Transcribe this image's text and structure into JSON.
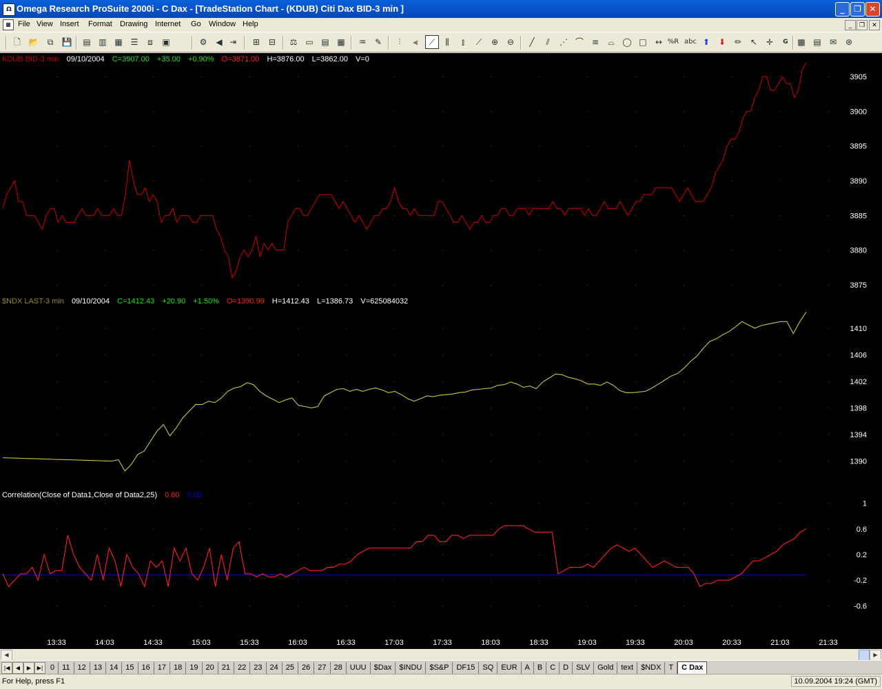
{
  "window": {
    "title": "Omega Research ProSuite 2000i - C Dax - [TradeStation Chart - (KDUB) Citi Dax BID-3 min ]",
    "icon": "tradestation-app-icon",
    "doc_icon": "chart-document-icon",
    "controls": [
      "minimize-icon",
      "restore-icon",
      "close-icon"
    ]
  },
  "menu": {
    "items": [
      "File",
      "View",
      "Insert",
      "Format",
      "Drawing",
      "Internet",
      "Go",
      "Window",
      "Help"
    ],
    "mdi_controls": [
      "minimize-icon",
      "restore-icon",
      "close-icon"
    ]
  },
  "toolbar": {
    "icons": [
      "new-icon",
      "open-icon",
      "copy-icon",
      "save-icon",
      "print-icon",
      "layout-icon",
      "layout-icon",
      "layout-icon",
      "layout-icon",
      "settings-icon",
      "back-icon",
      "forward-icon",
      "insert-icon",
      "insert-icon",
      "indicator-icon",
      "window-icon",
      "grid-icon",
      "table-icon",
      "pattern-icon",
      "paint-icon",
      "bar-chart-icon",
      "zoom-bars-icon",
      "line-chart-icon",
      "candle-icon",
      "candle-icon",
      "trend-icon",
      "zoom-in-icon",
      "zoom-out-icon",
      "curve-icon",
      "fibonacci-icon",
      "fan-icon",
      "arc-icon",
      "lines-icon",
      "speed-icon",
      "ellipse-icon",
      "rectangle-icon",
      "horizontal-arrow-icon",
      "percent-retracement-icon",
      "text-icon",
      "buy-arrow-icon",
      "sell-arrow-icon",
      "pencil-icon",
      "pointer-icon",
      "crosshair-icon",
      "grid-marker-icon",
      "chart-icon",
      "table-icon",
      "sound-icon",
      "camera-icon"
    ],
    "active": "line-chart-icon",
    "glyphs": {
      "percent_r": "%R",
      "abc": "abc",
      "g": "G"
    }
  },
  "chart": {
    "panes": [
      {
        "header": {
          "symbol": "KDUB BID-3 min",
          "date": "09/10/2004",
          "close": "C=3907.00",
          "change": "+35.00",
          "pct": "+0.90%",
          "open": "O=3871.00",
          "high": "H=3876.00",
          "low": "L=3862.00",
          "volume": "V=0"
        },
        "axis_labels": [
          "3905",
          "3900",
          "3895",
          "3890",
          "3885",
          "3880",
          "3875"
        ]
      },
      {
        "header": {
          "symbol": "$NDX LAST-3 min",
          "date": "09/10/2004",
          "close": "C=1412.43",
          "change": "+20.90",
          "pct": "+1.50%",
          "open": "O=1390.99",
          "high": "H=1412.43",
          "low": "L=1386.73",
          "volume": "V=625084032"
        },
        "axis_labels": [
          "1410",
          "1406",
          "1402",
          "1398",
          "1394",
          "1390"
        ]
      },
      {
        "header": {
          "study": "Correlation(Close of Data1,Close of Data2,25)",
          "value1": "0.60",
          "value2": "0.00"
        },
        "axis_labels": [
          "1",
          "0.6",
          "0.2",
          "-0.2",
          "-0.6"
        ]
      }
    ],
    "time_labels": [
      "13:33",
      "14:03",
      "14:33",
      "15:03",
      "15:33",
      "16:03",
      "16:33",
      "17:03",
      "17:33",
      "18:03",
      "18:33",
      "19:03",
      "19:33",
      "20:03",
      "20:33",
      "21:03",
      "21:33"
    ],
    "colors": {
      "kdub_line": "#c00000",
      "kdub_symbol": "#c00000",
      "ndx_line": "#c8c832",
      "ndx_symbol": "#8c8c32",
      "correlation_line": "#ff2020",
      "zero_line": "#0000e0",
      "positive": "#20e020",
      "negative": "#ff2020",
      "text": "#ffffff",
      "grid_dot": "#5a5a5a"
    }
  },
  "chart_data": [
    {
      "type": "line",
      "series": [
        {
          "name": "KDUB BID-3 min",
          "values": [
            3886,
            3888,
            3889,
            3890,
            3887,
            3887,
            3885,
            3885,
            3885,
            3884,
            3883,
            3885,
            3886,
            3886,
            3884,
            3885,
            3884,
            3884,
            3884,
            3885,
            3886,
            3885,
            3885,
            3885,
            3886,
            3885,
            3885,
            3885,
            3886,
            3885,
            3885,
            3888,
            3893,
            3890,
            3888,
            3888,
            3889,
            3887,
            3888,
            3887,
            3884,
            3885,
            3885,
            3886,
            3884,
            3885,
            3885,
            3885,
            3884,
            3884,
            3885,
            3885,
            3885,
            3885,
            3883,
            3882,
            3880,
            3879,
            3876,
            3877,
            3879,
            3880,
            3879,
            3880,
            3882,
            3879,
            3881,
            3880,
            3881,
            3880,
            3880,
            3880,
            3884,
            3885,
            3886,
            3886,
            3885,
            3885,
            3886,
            3887,
            3888,
            3888,
            3888,
            3888,
            3887,
            3886,
            3887,
            3886,
            3885,
            3884,
            3885,
            3884,
            3883,
            3884,
            3885,
            3885,
            3886,
            3886,
            3887,
            3889,
            3887,
            3886,
            3886,
            3885,
            3886,
            3885,
            3885,
            3885,
            3885,
            3885,
            3887,
            3887,
            3886,
            3885,
            3884,
            3884,
            3885,
            3884,
            3883,
            3884,
            3884,
            3885,
            3884,
            3884,
            3885,
            3885,
            3886,
            3886,
            3885,
            3885,
            3886,
            3886,
            3886,
            3885,
            3886,
            3886,
            3886,
            3886,
            3886,
            3887,
            3886,
            3886,
            3885,
            3886,
            3886,
            3886,
            3886,
            3885,
            3886,
            3885,
            3885,
            3886,
            3887,
            3886,
            3886,
            3886,
            3887,
            3886,
            3885,
            3886,
            3887,
            3887,
            3888,
            3888,
            3888,
            3889,
            3889,
            3889,
            3889,
            3889,
            3888,
            3887,
            3888,
            3889,
            3888,
            3887,
            3887,
            3887,
            3888,
            3889,
            3891,
            3892,
            3893,
            3895,
            3896,
            3896,
            3897,
            3899,
            3900,
            3900,
            3902,
            3903,
            3905,
            3905,
            3903,
            3903,
            3904,
            3905,
            3904,
            3904,
            3902,
            3903,
            3906,
            3907
          ]
        }
      ],
      "ylim": [
        3874,
        3907
      ]
    },
    {
      "type": "line",
      "series": [
        {
          "name": "$NDX LAST-3 min",
          "values": [
            1390.5,
            1390.47,
            1390.44,
            1390.41,
            1390.38,
            1390.35,
            1390.32,
            1390.29,
            1390.26,
            1390.23,
            1390.2,
            1390.17,
            1390.14,
            1390.11,
            1390.08,
            1390.05,
            1390.02,
            1390.0,
            1390.2,
            1388.5,
            1389.5,
            1391,
            1391.5,
            1393,
            1394.5,
            1395.5,
            1393.8,
            1395,
            1396.5,
            1397.5,
            1398.5,
            1398.5,
            1399,
            1398.8,
            1399.5,
            1400.5,
            1401,
            1401.2,
            1401.8,
            1401.5,
            1400.5,
            1399.8,
            1399.3,
            1398.8,
            1399.2,
            1399.5,
            1398.4,
            1398.2,
            1398.0,
            1398.2,
            1399.8,
            1400.3,
            1400.8,
            1400.9,
            1400.5,
            1400.8,
            1400.5,
            1400.8,
            1401.0,
            1400.7,
            1400.3,
            1400.5,
            1400.0,
            1399.4,
            1399.0,
            1399.4,
            1399.8,
            1399.7,
            1399.9,
            1400.0,
            1400.1,
            1400.3,
            1400.4,
            1400.7,
            1400.8,
            1400.9,
            1401.0,
            1401.4,
            1401.5,
            1401.9,
            1401.6,
            1401.1,
            1401.3,
            1400.9,
            1401.9,
            1402.5,
            1403.1,
            1403.0,
            1402.6,
            1402.4,
            1402.1,
            1401.6,
            1401.6,
            1401.4,
            1401.9,
            1401.4,
            1400.6,
            1400.3,
            1400.3,
            1400.4,
            1400.5,
            1401.0,
            1401.6,
            1402.2,
            1402.8,
            1403.2,
            1404.0,
            1405.0,
            1405.8,
            1407.0,
            1408.0,
            1408.4,
            1409.0,
            1409.5,
            1410.2,
            1411.0,
            1410.5,
            1410.0,
            1410.4,
            1410.6,
            1410.8,
            1411.0,
            1411.0,
            1409.2,
            1411.0,
            1412.43
          ]
        }
      ],
      "ylim": [
        1386,
        1413
      ]
    },
    {
      "type": "line",
      "series": [
        {
          "name": "Correlation(Close of Data1,Close of Data2,25)",
          "values": [
            -0.1,
            -0.3,
            -0.2,
            -0.1,
            -0.1,
            0.0,
            -0.2,
            0.2,
            -0.1,
            -0.05,
            -0.05,
            0.5,
            0.2,
            0.0,
            -0.1,
            -0.2,
            0.2,
            -0.2,
            0.3,
            0.1,
            -0.3,
            0.2,
            0.0,
            -0.1,
            -0.3,
            0.1,
            0.0,
            0.1,
            -0.3,
            0.3,
            0.1,
            0.3,
            -0.1,
            -0.2,
            0.0,
            0.3,
            -0.3,
            0.2,
            -0.2,
            0.3,
            0.4,
            -0.1,
            -0.1,
            -0.15,
            -0.1,
            -0.15,
            -0.15,
            -0.1,
            -0.15,
            -0.1,
            -0.05,
            0.0,
            -0.05,
            -0.05,
            -0.05,
            0.0,
            0.0,
            0.05,
            0.05,
            0.1,
            0.2,
            0.25,
            0.3,
            0.3,
            0.3,
            0.3,
            0.3,
            0.3,
            0.3,
            0.3,
            0.4,
            0.4,
            0.5,
            0.5,
            0.4,
            0.4,
            0.5,
            0.5,
            0.45,
            0.5,
            0.5,
            0.5,
            0.5,
            0.5,
            0.6,
            0.65,
            0.65,
            0.65,
            0.65,
            0.6,
            0.55,
            0.55,
            0.55,
            0.55,
            -0.1,
            -0.05,
            0.0,
            0.0,
            0.0,
            0.05,
            0.0,
            0.1,
            0.2,
            0.3,
            0.35,
            0.3,
            0.25,
            0.3,
            0.2,
            0.1,
            0.0,
            0.05,
            0.1,
            0.05,
            0.0,
            0.0,
            0.0,
            -0.1,
            -0.3,
            -0.25,
            -0.25,
            -0.2,
            -0.2,
            -0.2,
            -0.15,
            -0.1,
            0.0,
            0.1,
            0.1,
            0.15,
            0.2,
            0.25,
            0.35,
            0.4,
            0.45,
            0.55,
            0.6
          ]
        },
        {
          "name": "zero",
          "values": [
            0,
            0
          ]
        }
      ],
      "ylim": [
        -0.8,
        1.05
      ]
    }
  ],
  "tabs": {
    "items": [
      "0",
      "11",
      "12",
      "13",
      "14",
      "15",
      "16",
      "17",
      "18",
      "19",
      "20",
      "21",
      "22",
      "23",
      "24",
      "25",
      "26",
      "27",
      "28",
      "UUU",
      "$Dax",
      "$INDU",
      "$S&P",
      "DF15",
      "SQ",
      "EUR",
      "A",
      "B",
      "C",
      "D",
      "SLV",
      "Gold",
      "text",
      "$NDX",
      "T",
      "C Dax"
    ],
    "active": "C Dax",
    "nav_icons": [
      "first-tab-icon",
      "prev-tab-icon",
      "next-tab-icon",
      "last-tab-icon"
    ]
  },
  "status": {
    "help": "For Help, press F1",
    "datetime": "10.09.2004 19:24 (GMT)"
  }
}
